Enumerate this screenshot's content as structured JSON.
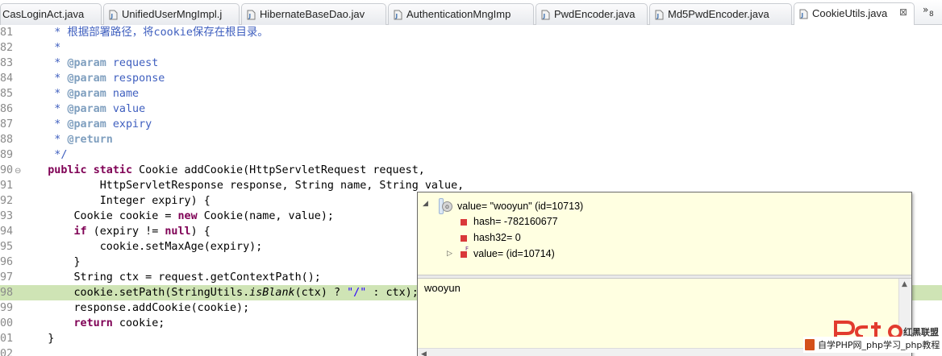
{
  "tabs": [
    {
      "label": "CasLoginAct.java"
    },
    {
      "label": "UnifiedUserMngImpl.j"
    },
    {
      "label": "HibernateBaseDao.jav"
    },
    {
      "label": "AuthenticationMngImp"
    },
    {
      "label": "PwdEncoder.java"
    },
    {
      "label": "Md5PwdEncoder.java"
    },
    {
      "label": "CookieUtils.java",
      "active": true
    }
  ],
  "tab_overflow": {
    "chevron": "»",
    "count": "8"
  },
  "icons": {
    "java_file": "java-file-icon",
    "close": "close-icon",
    "object": "object-icon",
    "field": "field-icon"
  },
  "colors": {
    "keyword": "#7f0055",
    "comment": "#3f5fbf",
    "javadoc_tag": "#7f9fbf",
    "string": "#2a00ff",
    "highlight": "#cfe4b5",
    "hover_bg": "#ffffe1"
  },
  "code": {
    "line_numbers": [
      "81",
      "82",
      "83",
      "84",
      "85",
      "86",
      "87",
      "88",
      "89",
      "90",
      "91",
      "92",
      "93",
      "94",
      "95",
      "96",
      "97",
      "98",
      "99",
      "00",
      "01",
      "02"
    ],
    "lines": [
      [
        {
          "t": "     * 根据部署路径，将cookie保存在根目录。",
          "c": "cm"
        }
      ],
      [
        {
          "t": "     *",
          "c": "cm"
        }
      ],
      [
        {
          "t": "     * ",
          "c": "cm"
        },
        {
          "t": "@param",
          "c": "tag"
        },
        {
          "t": " request",
          "c": "cm"
        }
      ],
      [
        {
          "t": "     * ",
          "c": "cm"
        },
        {
          "t": "@param",
          "c": "tag"
        },
        {
          "t": " response",
          "c": "cm"
        }
      ],
      [
        {
          "t": "     * ",
          "c": "cm"
        },
        {
          "t": "@param",
          "c": "tag"
        },
        {
          "t": " name",
          "c": "cm"
        }
      ],
      [
        {
          "t": "     * ",
          "c": "cm"
        },
        {
          "t": "@param",
          "c": "tag"
        },
        {
          "t": " value",
          "c": "cm"
        }
      ],
      [
        {
          "t": "     * ",
          "c": "cm"
        },
        {
          "t": "@param",
          "c": "tag"
        },
        {
          "t": " expiry",
          "c": "cm"
        }
      ],
      [
        {
          "t": "     * ",
          "c": "cm"
        },
        {
          "t": "@return",
          "c": "tag"
        }
      ],
      [
        {
          "t": "     */",
          "c": "cm"
        }
      ],
      [
        {
          "t": "    "
        },
        {
          "t": "public",
          "c": "kw"
        },
        {
          "t": " "
        },
        {
          "t": "static",
          "c": "kw"
        },
        {
          "t": " Cookie addCookie(HttpServletRequest request,"
        }
      ],
      [
        {
          "t": "            HttpServletResponse response, String name, String value,"
        }
      ],
      [
        {
          "t": "            Integer expiry) {"
        }
      ],
      [
        {
          "t": "        Cookie cookie = "
        },
        {
          "t": "new",
          "c": "kw"
        },
        {
          "t": " Cookie(name, value);"
        }
      ],
      [
        {
          "t": "        "
        },
        {
          "t": "if",
          "c": "kw"
        },
        {
          "t": " (expiry != "
        },
        {
          "t": "null",
          "c": "kw"
        },
        {
          "t": ") {"
        }
      ],
      [
        {
          "t": "            cookie.setMaxAge(expiry);"
        }
      ],
      [
        {
          "t": "        }"
        }
      ],
      [
        {
          "t": "        String ctx = request.getContextPath();"
        }
      ],
      [
        {
          "t": "        cookie.setPath(StringUtils."
        },
        {
          "t": "isBlank",
          "c": "it"
        },
        {
          "t": "(ctx) ? "
        },
        {
          "t": "\"/\"",
          "c": "str"
        },
        {
          "t": " : ctx);"
        }
      ],
      [
        {
          "t": "        response.addCookie(cookie);"
        }
      ],
      [
        {
          "t": "        "
        },
        {
          "t": "return",
          "c": "kw"
        },
        {
          "t": " cookie;"
        }
      ],
      [
        {
          "t": "    }"
        }
      ],
      [
        {
          "t": ""
        }
      ]
    ],
    "highlighted_line_index": 17,
    "fold_marker": "⊖"
  },
  "debug_hover": {
    "root": "value= \"wooyun\" (id=10713)",
    "children": [
      {
        "label": "hash= -782160677",
        "expandable": false
      },
      {
        "label": "hash32= 0",
        "expandable": false
      },
      {
        "label": "value=  (id=10714)",
        "expandable": true
      }
    ],
    "detail_value": "wooyun",
    "expand_glyph": "◢",
    "collapsed_glyph": "▷",
    "scroll_up_glyph": "▲",
    "scroll_left_glyph": "◀",
    "final_marker": "F"
  },
  "watermark": {
    "site_label": "红黑联盟",
    "bar_text": "自学PHP网_php学习_php教程"
  }
}
